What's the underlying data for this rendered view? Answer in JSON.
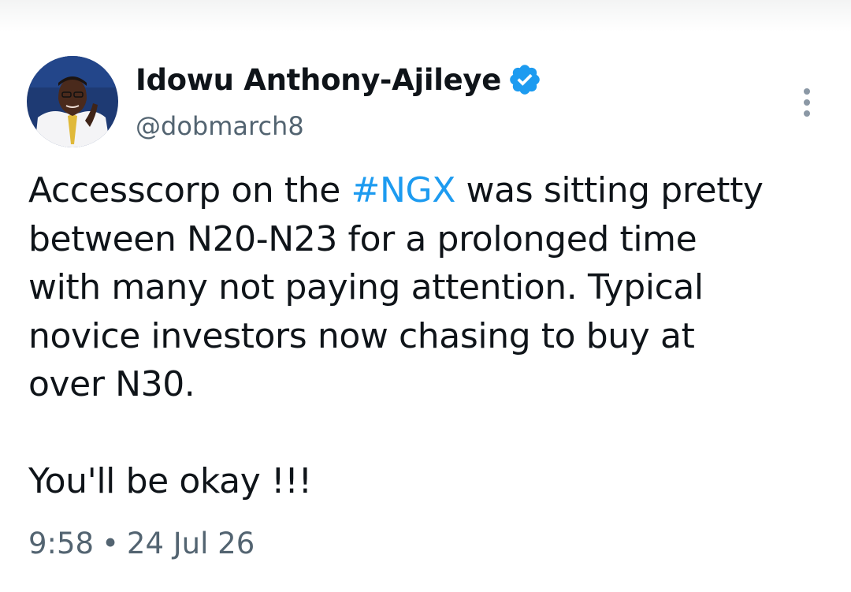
{
  "tweet": {
    "author": {
      "display_name": "Idowu Anthony-Ajileye",
      "handle": "@dobmarch8",
      "verified_icon": "verified-badge-icon",
      "avatar_icon": "avatar"
    },
    "text": {
      "line1_before": "Accesscorp on the ",
      "hashtag": "#NGX",
      "line1_after": " was sitting pretty",
      "line2": "between N20-N23 for a prolonged time",
      "line3": "with many not paying attention. Typical",
      "line4": "novice investors now chasing to buy at",
      "line5": "over N30.",
      "line6": "You'll be okay !!!"
    },
    "time": "9:58",
    "separator": "•",
    "date": "24 Jul 26",
    "more_icon": "more-options-icon"
  },
  "colors": {
    "text": "#0f1419",
    "secondary": "#536471",
    "link": "#1d9bf0",
    "verified": "#1d9bf0"
  }
}
